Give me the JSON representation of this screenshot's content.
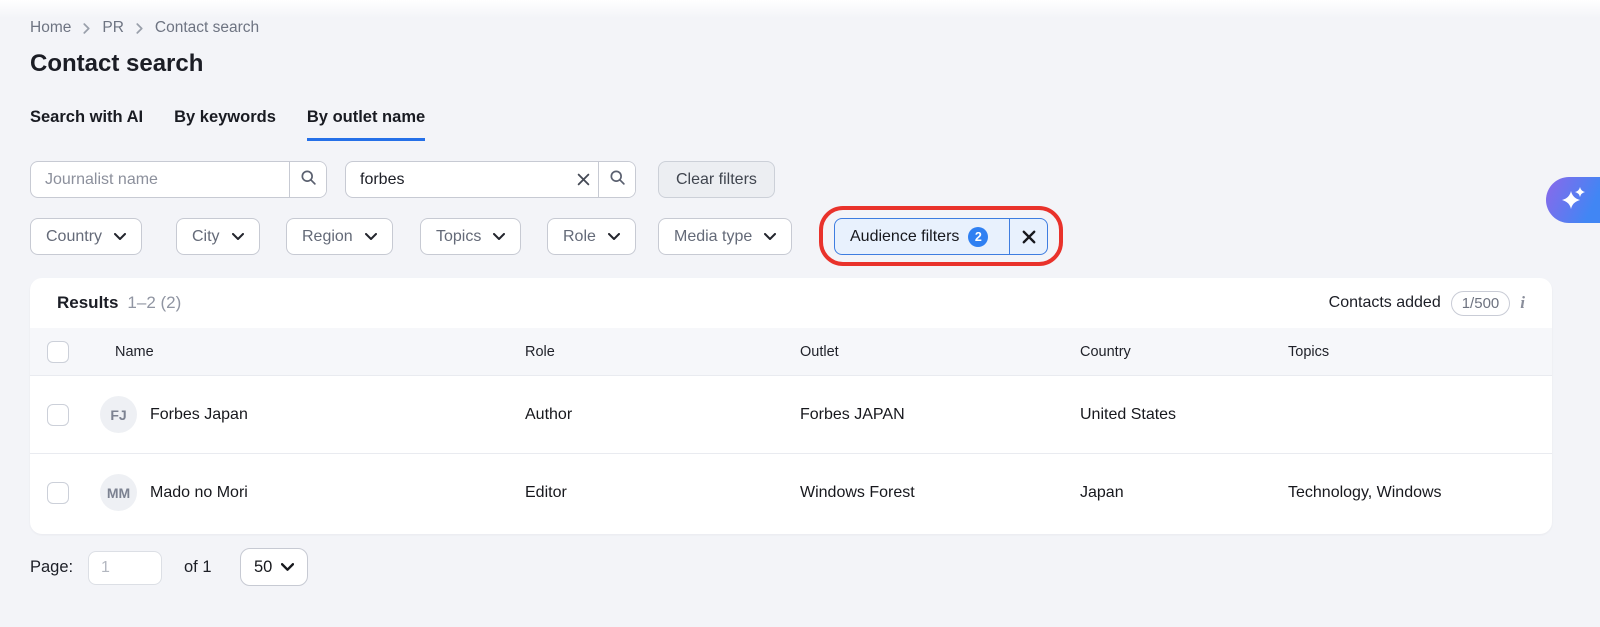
{
  "breadcrumb": {
    "items": [
      "Home",
      "PR",
      "Contact search"
    ]
  },
  "page": {
    "title": "Contact search"
  },
  "tabs": [
    {
      "label": "Search with AI",
      "active": false
    },
    {
      "label": "By keywords",
      "active": false
    },
    {
      "label": "By outlet name",
      "active": true
    }
  ],
  "search": {
    "journalist_placeholder": "Journalist name",
    "outlet_value": "forbes",
    "clear_filters": "Clear filters"
  },
  "filters": {
    "dropdowns": [
      "Country",
      "City",
      "Region",
      "Topics",
      "Role",
      "Media type"
    ],
    "audience": {
      "label": "Audience filters",
      "count": "2"
    }
  },
  "results": {
    "title": "Results",
    "range": "1–2 (2)",
    "contacts_added": {
      "label": "Contacts added",
      "count": "1/500"
    },
    "columns": [
      "Name",
      "Role",
      "Outlet",
      "Country",
      "Topics"
    ],
    "rows": [
      {
        "initials": "FJ",
        "name": "Forbes Japan",
        "role": "Author",
        "outlet": "Forbes JAPAN",
        "country": "United States",
        "topics": ""
      },
      {
        "initials": "MM",
        "name": "Mado no Mori",
        "role": "Editor",
        "outlet": "Windows Forest",
        "country": "Japan",
        "topics": "Technology, Windows"
      }
    ]
  },
  "pagination": {
    "label": "Page:",
    "value": "1",
    "of": "of 1",
    "page_size": "50"
  },
  "colors": {
    "accent_blue": "#2570e8",
    "chip_bg": "#e8f1fd",
    "chip_border": "#3e7de0",
    "badge_blue": "#2f80f2",
    "annotation_red": "#e9322b",
    "ai_gradient_from": "#8b68ea",
    "ai_gradient_to": "#4186f4",
    "page_bg": "#f3f4f8"
  }
}
